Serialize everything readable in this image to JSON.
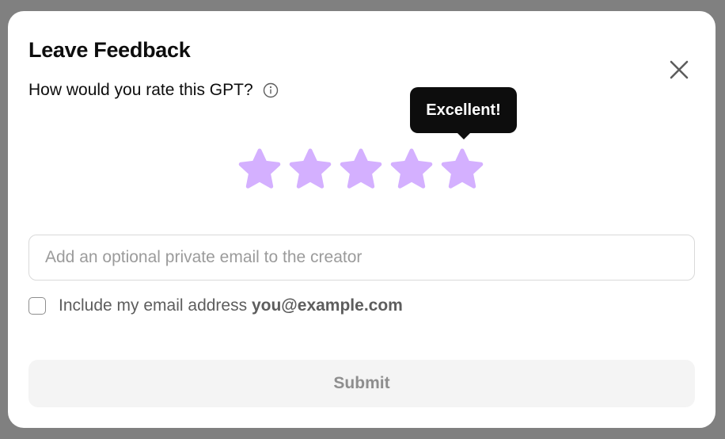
{
  "dialog": {
    "title": "Leave Feedback",
    "question": "How would you rate this GPT?",
    "info_icon": "info-circle-icon",
    "close_icon": "close-icon"
  },
  "rating": {
    "max": 5,
    "value": 5,
    "tooltip": "Excellent!",
    "star_icon": "star-icon",
    "star_color": "#d4b0ff"
  },
  "email": {
    "placeholder": "Add an optional private email to the creator",
    "value": ""
  },
  "include_email": {
    "label": "Include my email address",
    "address": "you@example.com",
    "checked": false
  },
  "submit": {
    "label": "Submit"
  },
  "colors": {
    "overlay": "#808080",
    "tooltip_bg": "#0d0d0d",
    "submit_bg": "#f4f4f4"
  }
}
